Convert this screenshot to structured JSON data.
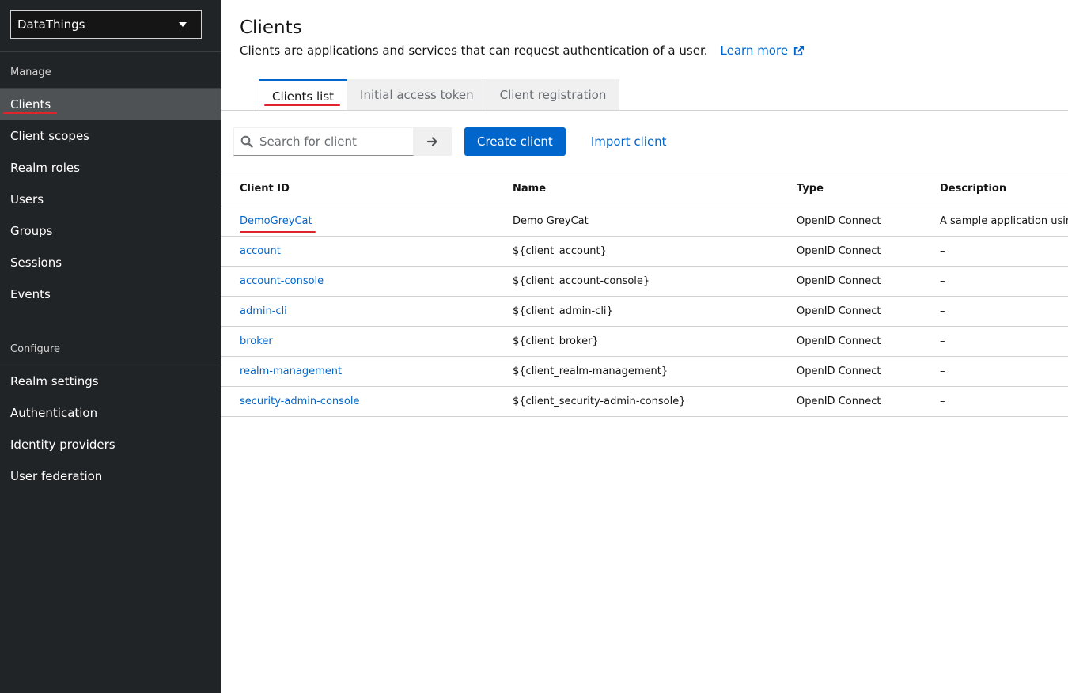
{
  "sidebar": {
    "realm": "DataThings",
    "manage_title": "Manage",
    "manage_items": [
      {
        "label": "Clients",
        "active": true
      },
      {
        "label": "Client scopes"
      },
      {
        "label": "Realm roles"
      },
      {
        "label": "Users"
      },
      {
        "label": "Groups"
      },
      {
        "label": "Sessions"
      },
      {
        "label": "Events"
      }
    ],
    "configure_title": "Configure",
    "configure_items": [
      {
        "label": "Realm settings"
      },
      {
        "label": "Authentication"
      },
      {
        "label": "Identity providers"
      },
      {
        "label": "User federation"
      }
    ]
  },
  "header": {
    "title": "Clients",
    "description": "Clients are applications and services that can request authentication of a user.",
    "learn_more": "Learn more"
  },
  "tabs": [
    {
      "label": "Clients list",
      "active": true
    },
    {
      "label": "Initial access token"
    },
    {
      "label": "Client registration"
    }
  ],
  "toolbar": {
    "search_placeholder": "Search for client",
    "create_label": "Create client",
    "import_label": "Import client"
  },
  "table": {
    "columns": [
      "Client ID",
      "Name",
      "Type",
      "Description"
    ],
    "rows": [
      {
        "id": "DemoGreyCat",
        "name": "Demo GreyCat",
        "type": "OpenID Connect",
        "description": "A sample application using"
      },
      {
        "id": "account",
        "name": "${client_account}",
        "type": "OpenID Connect",
        "description": "–"
      },
      {
        "id": "account-console",
        "name": "${client_account-console}",
        "type": "OpenID Connect",
        "description": "–"
      },
      {
        "id": "admin-cli",
        "name": "${client_admin-cli}",
        "type": "OpenID Connect",
        "description": "–"
      },
      {
        "id": "broker",
        "name": "${client_broker}",
        "type": "OpenID Connect",
        "description": "–"
      },
      {
        "id": "realm-management",
        "name": "${client_realm-management}",
        "type": "OpenID Connect",
        "description": "–"
      },
      {
        "id": "security-admin-console",
        "name": "${client_security-admin-console}",
        "type": "OpenID Connect",
        "description": "–"
      }
    ]
  },
  "colors": {
    "sidebar_bg": "#212427",
    "active_item_bg": "#4f5255",
    "link": "#0066cc",
    "primary_button": "#0066cc",
    "annotation_red": "#e0242b"
  }
}
